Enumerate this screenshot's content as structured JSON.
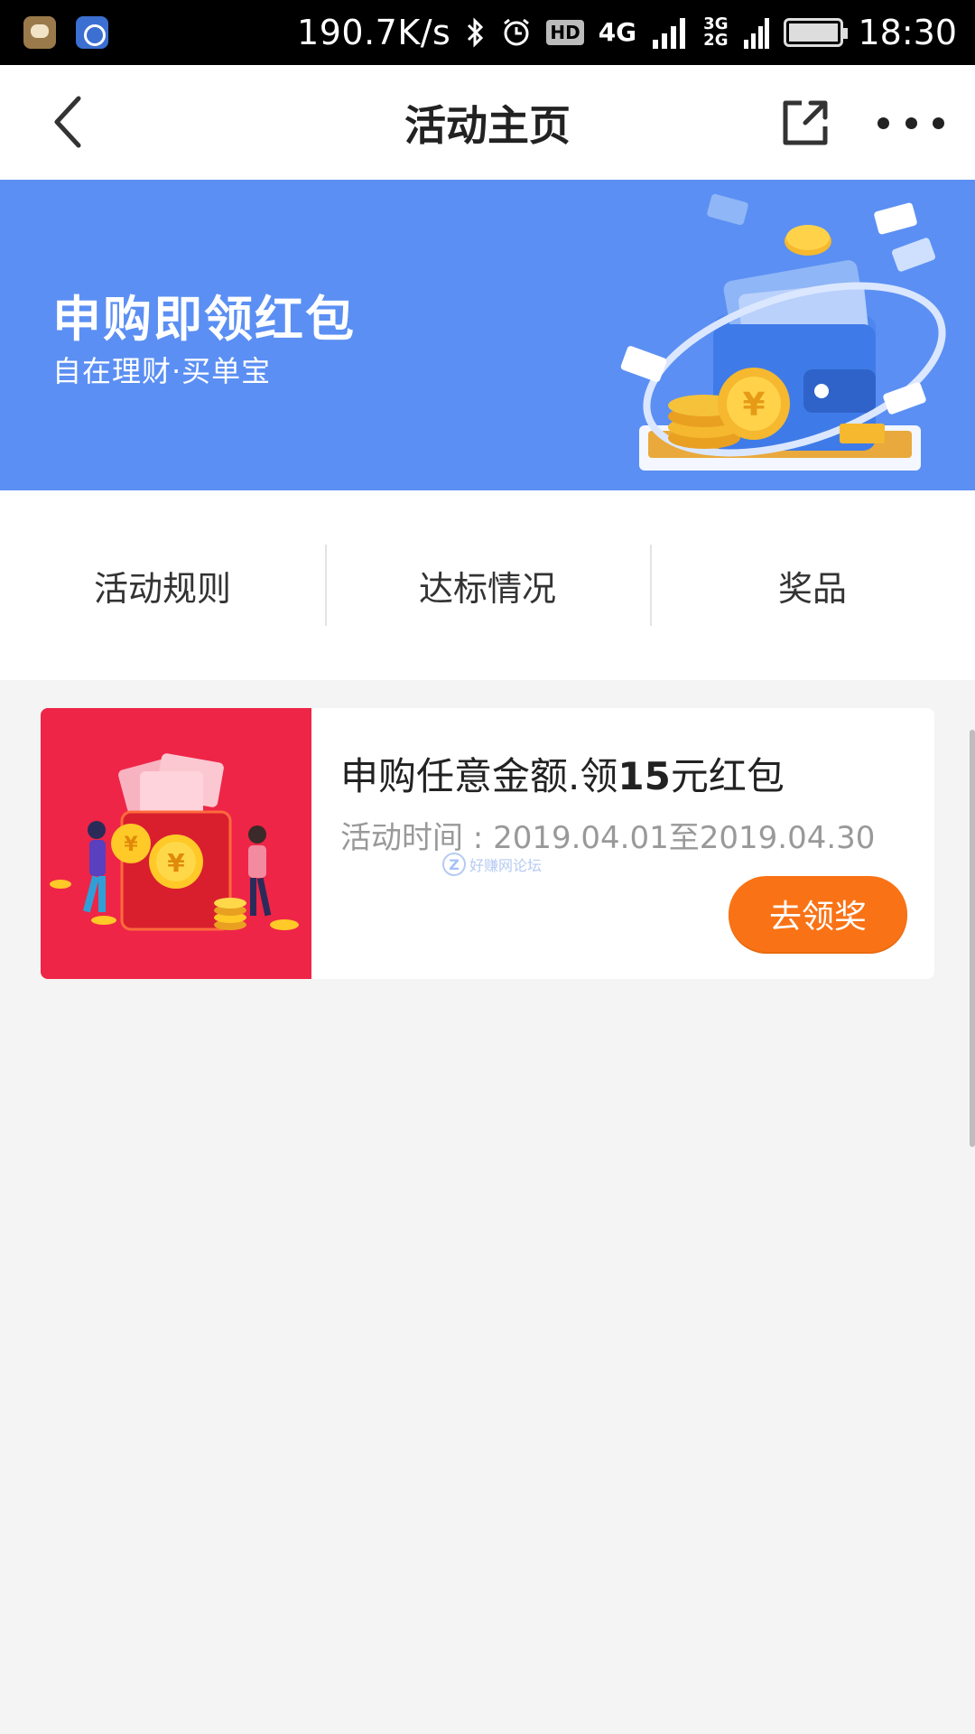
{
  "status_bar": {
    "speed": "190.7K/s",
    "hd": "HD",
    "net1": "4G",
    "net2_top": "3G",
    "net2_bottom": "2G",
    "time": "18:30"
  },
  "header": {
    "title": "活动主页"
  },
  "banner": {
    "title": "申购即领红包",
    "subtitle": "自在理财·买单宝"
  },
  "tabs": [
    {
      "label": "活动规则"
    },
    {
      "label": "达标情况"
    },
    {
      "label": "奖品"
    }
  ],
  "activity": {
    "title_prefix": "申购任意金额.领",
    "title_amount": "15",
    "title_suffix": "元红包",
    "time_label": "活动时间 : 2019.04.01至2019.04.30",
    "button_label": "去领奖",
    "watermark_text": "好赚网论坛"
  },
  "colors": {
    "banner_bg": "#5b8ff3",
    "card_image_bg": "#ee2547",
    "button_bg": "#f97316",
    "page_bg": "#f4f4f4"
  }
}
